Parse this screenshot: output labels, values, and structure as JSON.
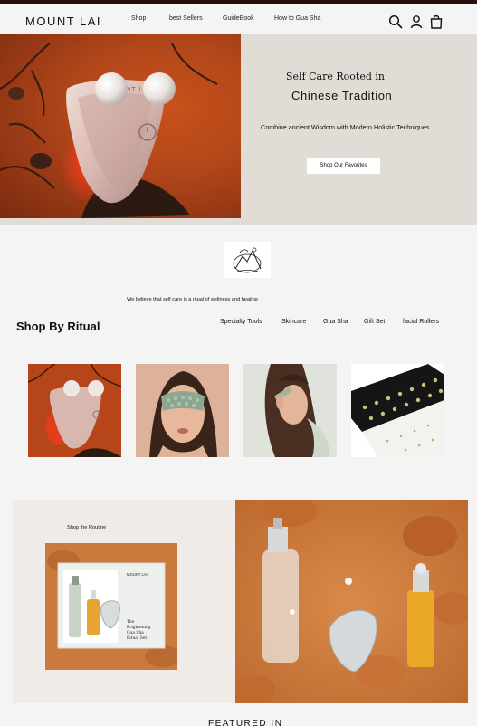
{
  "brand": {
    "logo": "MOUNT  LAI"
  },
  "nav": {
    "links": [
      "Shop",
      "best Sellers",
      "GuideBook",
      "How to Gua Sha"
    ],
    "icons": [
      "search-icon",
      "account-icon",
      "bag-icon"
    ]
  },
  "hero": {
    "subtitle1": "Self Care Rooted in",
    "subtitle2": "Chinese  Tradition",
    "description": "Combine  ancient Wisdom with Modern Holistic Techniques",
    "button": "Shop Our Favorites",
    "product_logo": "MOUNT LAI"
  },
  "belief": "We believe that self care is a ritual of wellness and healing",
  "ritual": {
    "title": "Shop By Ritual",
    "categories": [
      "Specialty Tools",
      "Skincare",
      "Gua Sha",
      "Gift Set",
      "facial Rollers"
    ]
  },
  "routine": {
    "label": "Shop the Routine",
    "box_brand": "MOUNT LAI",
    "box_title_1": "The",
    "box_title_2": "Brightening",
    "box_title_3": "Gua Sha",
    "box_title_4": "Ritual Set"
  },
  "featured": {
    "title": "FEATURED IN"
  },
  "colors": {
    "hero_orange": "#b3471a",
    "hero_beige": "#e1ddd6",
    "routine_bg": "#f1ebe7",
    "topbar": "#2a0d0d"
  }
}
